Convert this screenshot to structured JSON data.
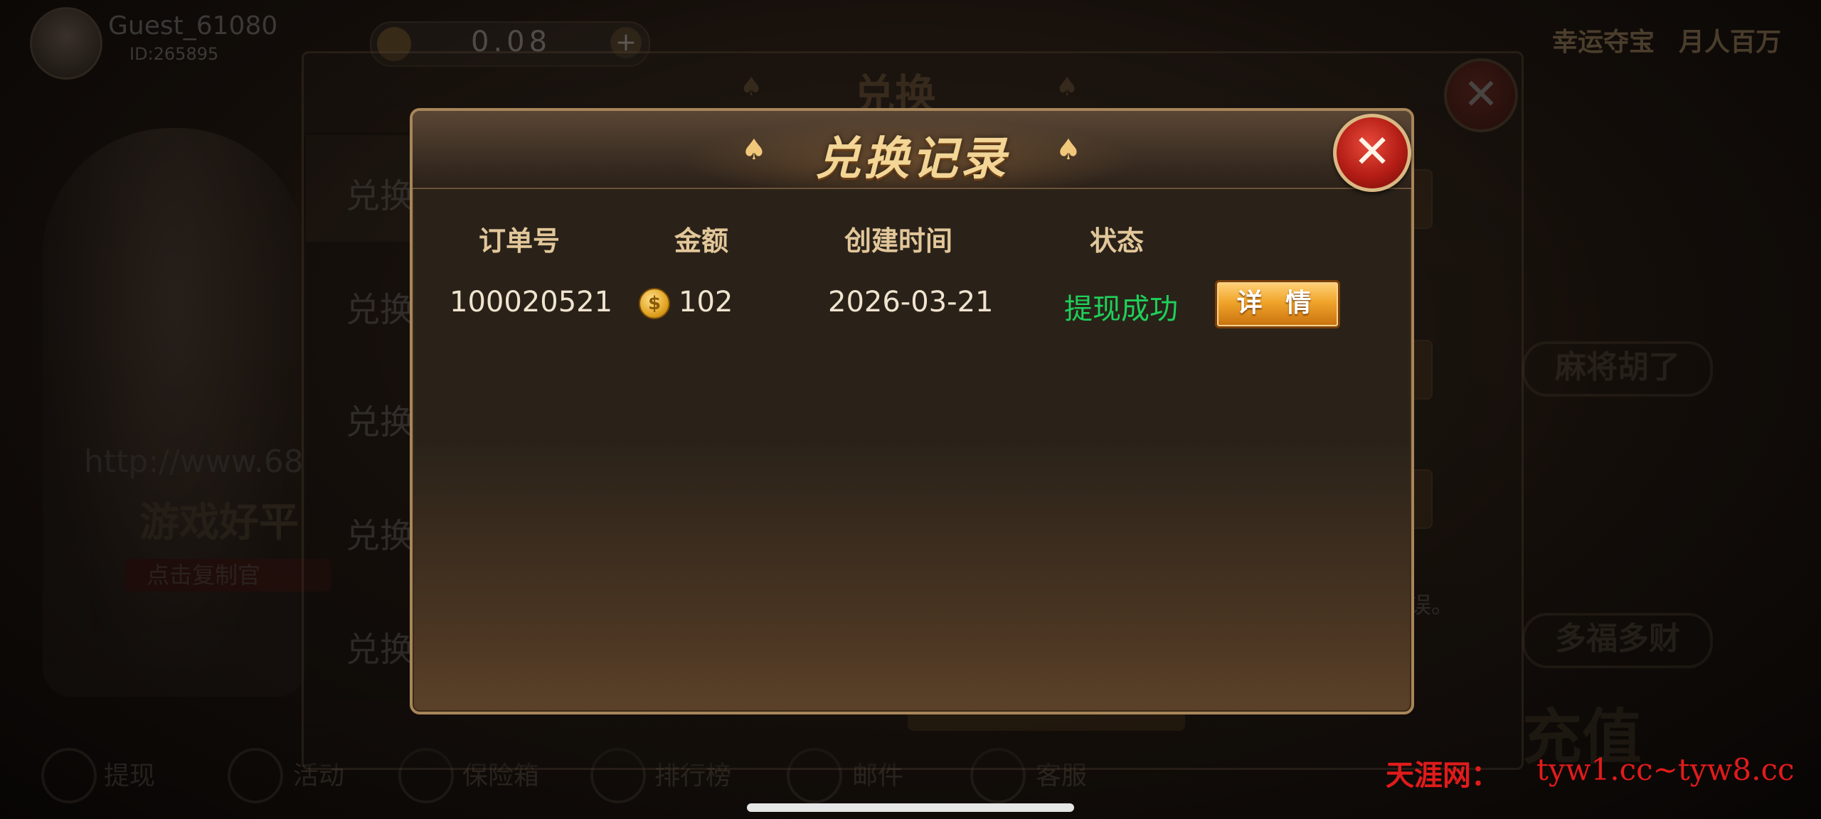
{
  "background": {
    "username": "Guest_61080",
    "user_id": "ID:265895",
    "coin_balance": "0.08",
    "top_right": [
      "幸运夺宝",
      "月人百万"
    ],
    "exchange_panel_title": "兑换",
    "tabs": [
      "兑换",
      "兑换",
      "兑换",
      "兑换",
      "兑换"
    ],
    "promo_url": "http://www.68",
    "promo_slogan": "游戏好平",
    "promo_copy": "点击复制官",
    "hint_text": "误。",
    "right_games": [
      "麻将胡了",
      "多福多财"
    ],
    "recharge_label": "充值",
    "bottom_nav": [
      "提现",
      "活动",
      "保险箱",
      "排行榜",
      "邮件",
      "客服"
    ]
  },
  "dialog": {
    "title": "兑换记录",
    "columns": [
      "订单号",
      "金额",
      "创建时间",
      "状态"
    ],
    "rows": [
      {
        "order_no": "100020521",
        "amount": "102",
        "created": "2026-03-21",
        "status": "提现成功",
        "action": "详 情"
      }
    ]
  },
  "watermark": {
    "site": "天涯网：",
    "urls": "tyw1.cc~tyw8.cc"
  },
  "colors": {
    "title_gold": "#f3d596",
    "status_green": "#1fd05a",
    "button_orange": "#f0a52a",
    "close_red": "#b31d15",
    "watermark_red": "#e11b1b"
  },
  "icons": [
    "spade-icon",
    "close-icon",
    "coin-icon"
  ]
}
